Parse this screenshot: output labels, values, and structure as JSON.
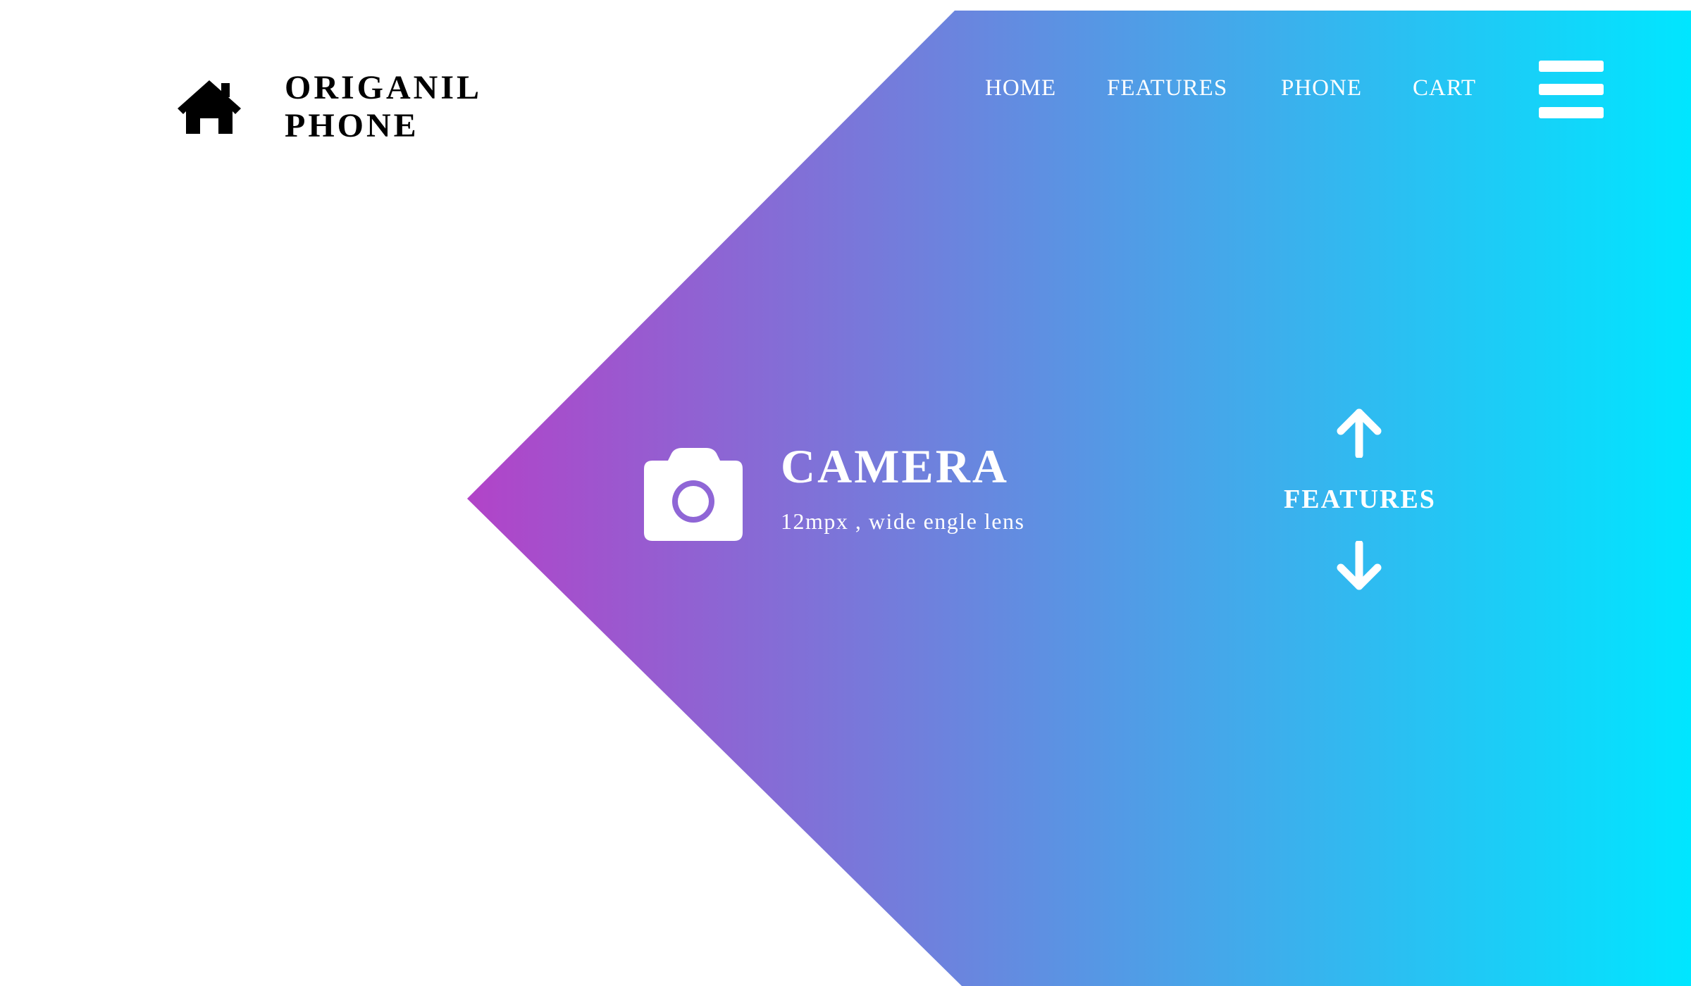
{
  "colors": {
    "gradient_start": "#b243c8",
    "gradient_end": "#00e6ff",
    "text_on_gradient": "#ffffff",
    "brand_text": "#000000"
  },
  "header": {
    "brand": {
      "icon": "home-icon",
      "line1": "ORIGANIL",
      "line2": "PHONE"
    },
    "nav": {
      "home": "HOME",
      "features": "FEATURES",
      "phone": "PHONE",
      "cart": "CART"
    },
    "menu_icon": "hamburger-menu-icon"
  },
  "feature": {
    "icon": "camera-icon",
    "title": "CAMERA",
    "description": "12mpx , wide engle lens"
  },
  "scroller": {
    "label": "FEATURES",
    "up_icon": "arrow-up-icon",
    "down_icon": "arrow-down-icon"
  }
}
